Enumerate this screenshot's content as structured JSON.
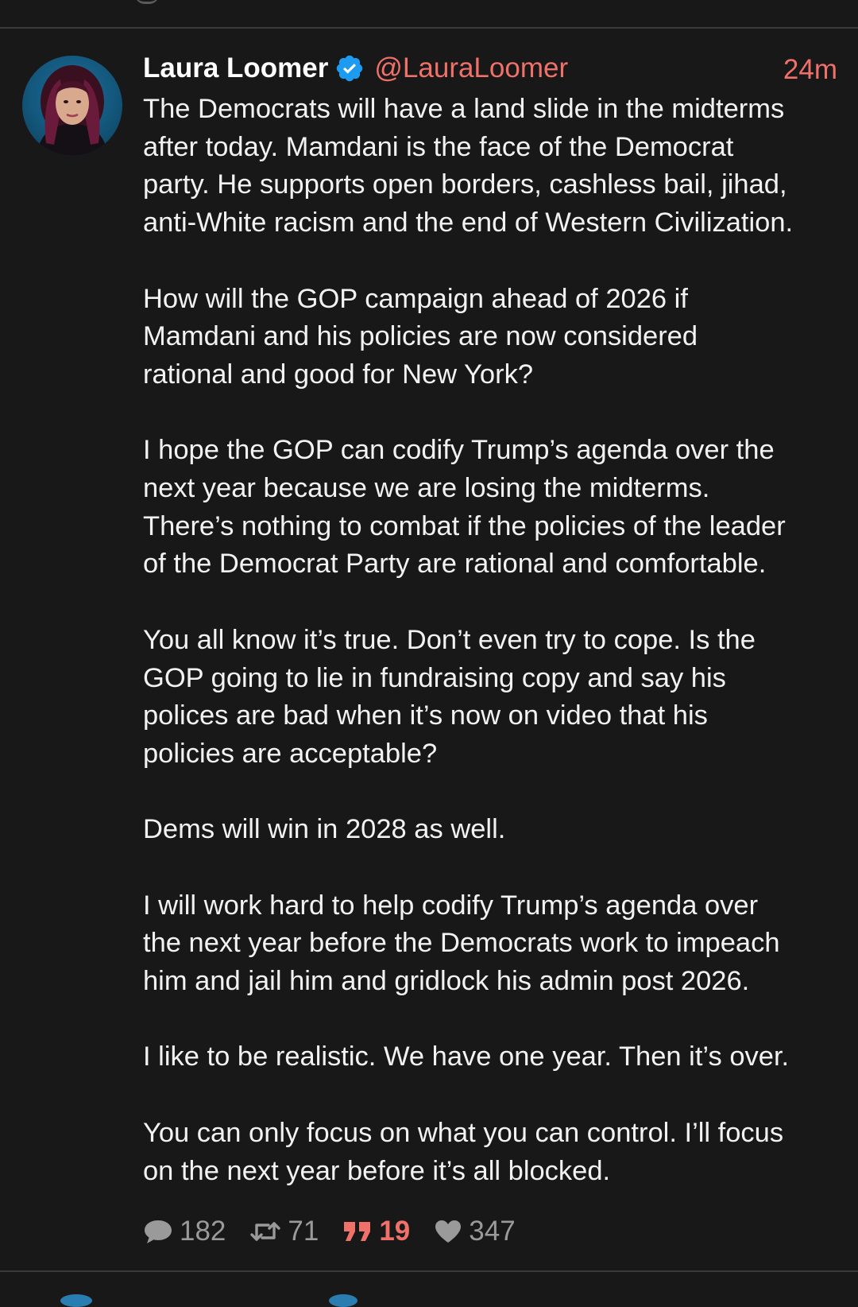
{
  "post": {
    "display_name": "Laura Loomer",
    "handle": "@LauraLoomer",
    "time": "24m",
    "paragraphs": [
      [
        "The Democrats will have a land slide in the midterms",
        "after today. Mamdani is the face of the Democrat",
        "party. He supports open borders, cashless bail, jihad,",
        "anti-White racism and the end of Western Civilization."
      ],
      [
        "How will the GOP campaign ahead of 2026 if",
        "Mamdani and his policies are now considered",
        "rational and good for New York?"
      ],
      [
        "I hope the GOP can codify Trump’s agenda over the",
        "next year because we are losing the midterms.",
        "There’s nothing to combat if the policies of the leader",
        "of the Democrat Party are rational and comfortable."
      ],
      [
        "You all know it’s true. Don’t even try to cope. Is the",
        "GOP going to lie in fundraising copy and say his",
        "polices are bad when it’s now on video that his",
        "policies are acceptable?"
      ],
      [
        "Dems will win in 2028 as well."
      ],
      [
        "I will work hard to help codify Trump’s agenda over",
        "the next year before the Democrats work to impeach",
        "him and jail him and gridlock his admin post 2026."
      ],
      [
        "I like to be realistic. We have one year. Then it’s over."
      ],
      [
        "You can only focus on what you can control. I’ll focus",
        "on the next year before it’s all blocked."
      ]
    ]
  },
  "stats": {
    "replies": "182",
    "reposts": "71",
    "quotes": "19",
    "likes": "347"
  },
  "icons": {
    "verified": "verified-badge-icon",
    "reply": "speech-bubble-icon",
    "repost": "repost-arrows-icon",
    "quote": "quote-marks-icon",
    "like": "heart-icon"
  },
  "colors": {
    "background": "#181818",
    "accent": "#f0706a",
    "verified": "#1d9bf0",
    "muted": "#9a9a9a",
    "divider": "#3a3a3a"
  }
}
